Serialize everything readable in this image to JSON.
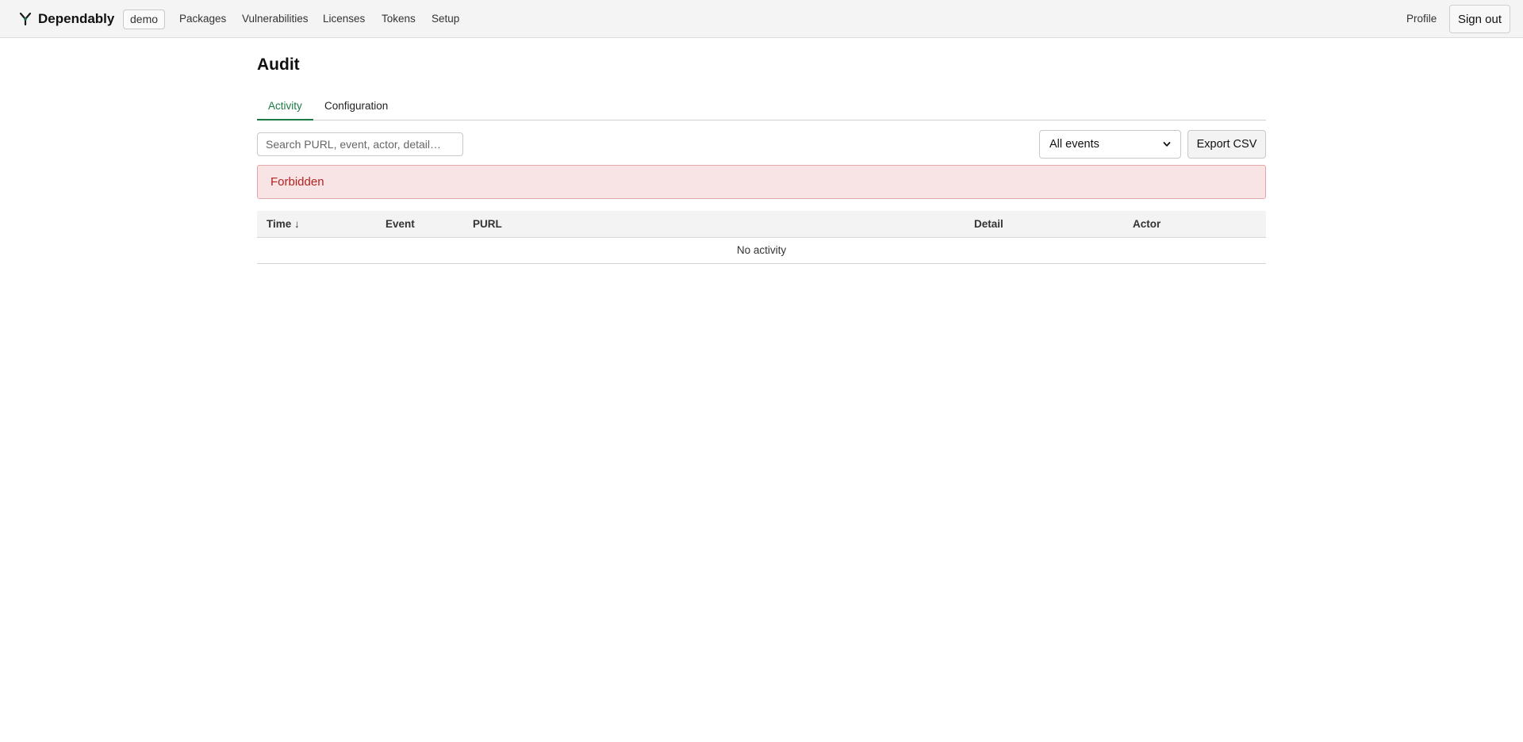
{
  "header": {
    "brand": "Dependably",
    "tenant": "demo",
    "nav": [
      "Packages",
      "Vulnerabilities",
      "Licenses",
      "Tokens",
      "Setup"
    ],
    "profile_label": "Profile",
    "signout_label": "Sign out"
  },
  "page": {
    "title": "Audit",
    "tabs": [
      {
        "label": "Activity",
        "active": true
      },
      {
        "label": "Configuration",
        "active": false
      }
    ]
  },
  "filters": {
    "search_placeholder": "Search PURL, event, actor, detail…",
    "events_selected": "All events",
    "export_label": "Export CSV"
  },
  "alert": {
    "message": "Forbidden"
  },
  "table": {
    "columns": [
      "Time",
      "Event",
      "PURL",
      "Detail",
      "Actor"
    ],
    "sort_indicator": "↓",
    "empty_message": "No activity"
  },
  "colors": {
    "accent": "#1b7a43",
    "error_text": "#b22222",
    "error_bg": "#f8e4e4"
  }
}
